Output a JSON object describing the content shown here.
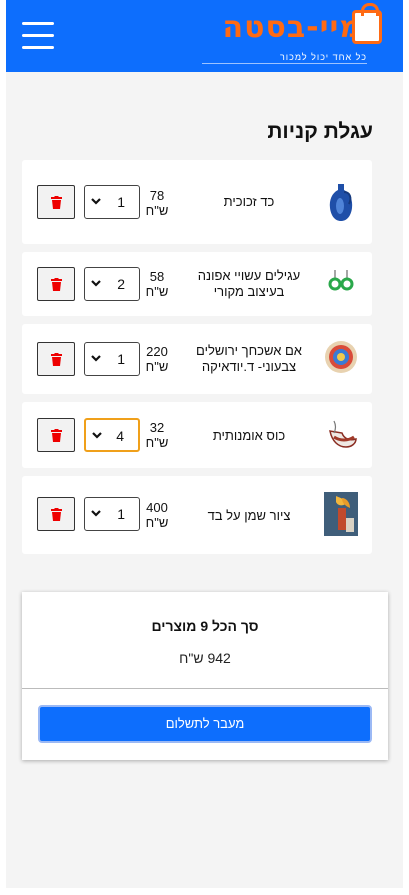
{
  "header": {
    "logo_text": "מיי-בסטה",
    "logo_tagline": "כל אחד יכול למכור",
    "menu_icon": "hamburger-menu-icon",
    "bg_color": "#0d6efd",
    "logo_color": "#ff6a13"
  },
  "cart": {
    "title": "עגלת קניות",
    "items": [
      {
        "name": "כד זכוכית",
        "price_value": "78",
        "price_unit": "ש\"ח",
        "quantity": "1",
        "thumb": "blue-glass-jug"
      },
      {
        "name": "עגילים עשויי אפונה בעיצוב מקורי",
        "price_value": "58",
        "price_unit": "ש\"ח",
        "quantity": "2",
        "thumb": "green-earrings"
      },
      {
        "name": "אם אשכחך ירושלים צבעוני- ד.יודאיקה",
        "price_value": "220",
        "price_unit": "ש\"ח",
        "quantity": "1",
        "thumb": "colorful-plate"
      },
      {
        "name": "כוס אומנותית",
        "price_value": "32",
        "price_unit": "ש\"ח",
        "quantity": "4",
        "thumb": "art-cup"
      },
      {
        "name": "ציור שמן על בד",
        "price_value": "400",
        "price_unit": "ש\"ח",
        "quantity": "1",
        "thumb": "oil-painting"
      }
    ]
  },
  "summary": {
    "title": "סך הכל 9 מוצרים",
    "total": "942 ש\"ח",
    "checkout_label": "מעבר לתשלום"
  }
}
